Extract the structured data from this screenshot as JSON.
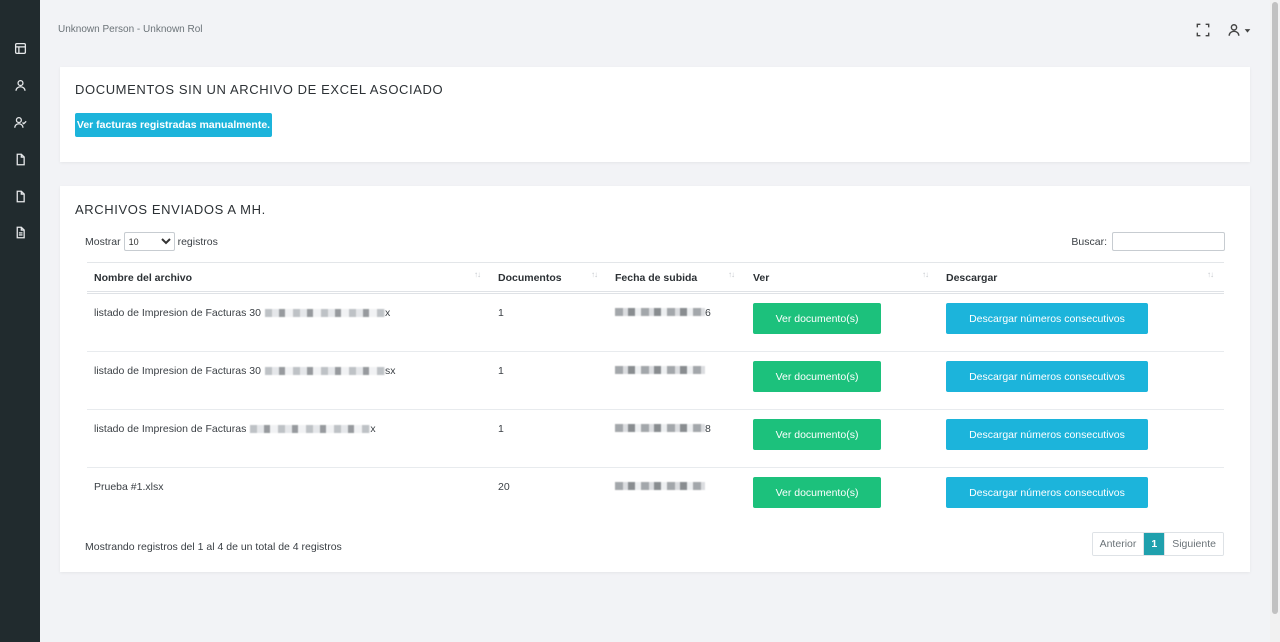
{
  "header": {
    "user_role": "Unknown Person - Unknown Rol"
  },
  "sidebar": {
    "items": [
      {
        "icon": "layout-icon"
      },
      {
        "icon": "user-icon"
      },
      {
        "icon": "user-check-icon"
      },
      {
        "icon": "file-icon"
      },
      {
        "icon": "file-icon"
      },
      {
        "icon": "file-text-icon"
      }
    ]
  },
  "card_unlinked": {
    "title": "DOCUMENTOS SIN UN ARCHIVO DE EXCEL ASOCIADO",
    "button_label": "Ver facturas registradas manualmente."
  },
  "card_sent": {
    "title": "ARCHIVOS ENVIADOS A MH.",
    "length_prefix": "Mostrar",
    "length_value": "10",
    "length_suffix": "registros",
    "search_label": "Buscar:",
    "columns": [
      "Nombre del archivo",
      "Documentos",
      "Fecha de subida",
      "Ver",
      "Descargar"
    ],
    "rows": [
      {
        "name": "listado de Impresion de Facturas 30",
        "name_suffix": "x",
        "documents": "1",
        "date_suffix": "6",
        "view_label": "Ver documento(s)",
        "download_label": "Descargar números consecutivos"
      },
      {
        "name": "listado de Impresion de Facturas 30",
        "name_suffix": "sx",
        "documents": "1",
        "date_suffix": "",
        "view_label": "Ver documento(s)",
        "download_label": "Descargar números consecutivos"
      },
      {
        "name": "listado de Impresion de Facturas",
        "name_suffix": "x",
        "documents": "1",
        "date_suffix": "8",
        "view_label": "Ver documento(s)",
        "download_label": "Descargar números consecutivos"
      },
      {
        "name": "Prueba #1.xlsx",
        "name_suffix": "",
        "documents": "20",
        "date_suffix": "",
        "view_label": "Ver documento(s)",
        "download_label": "Descargar números consecutivos"
      }
    ],
    "info": "Mostrando registros del 1 al 4 de un total de 4 registros",
    "pagination": {
      "prev": "Anterior",
      "current": "1",
      "next": "Siguiente"
    }
  },
  "colors": {
    "sidebar_bg": "#212b2e",
    "info_button": "#1cb4db",
    "success_button": "#1cc17c",
    "active_page": "#1fa0ad"
  }
}
